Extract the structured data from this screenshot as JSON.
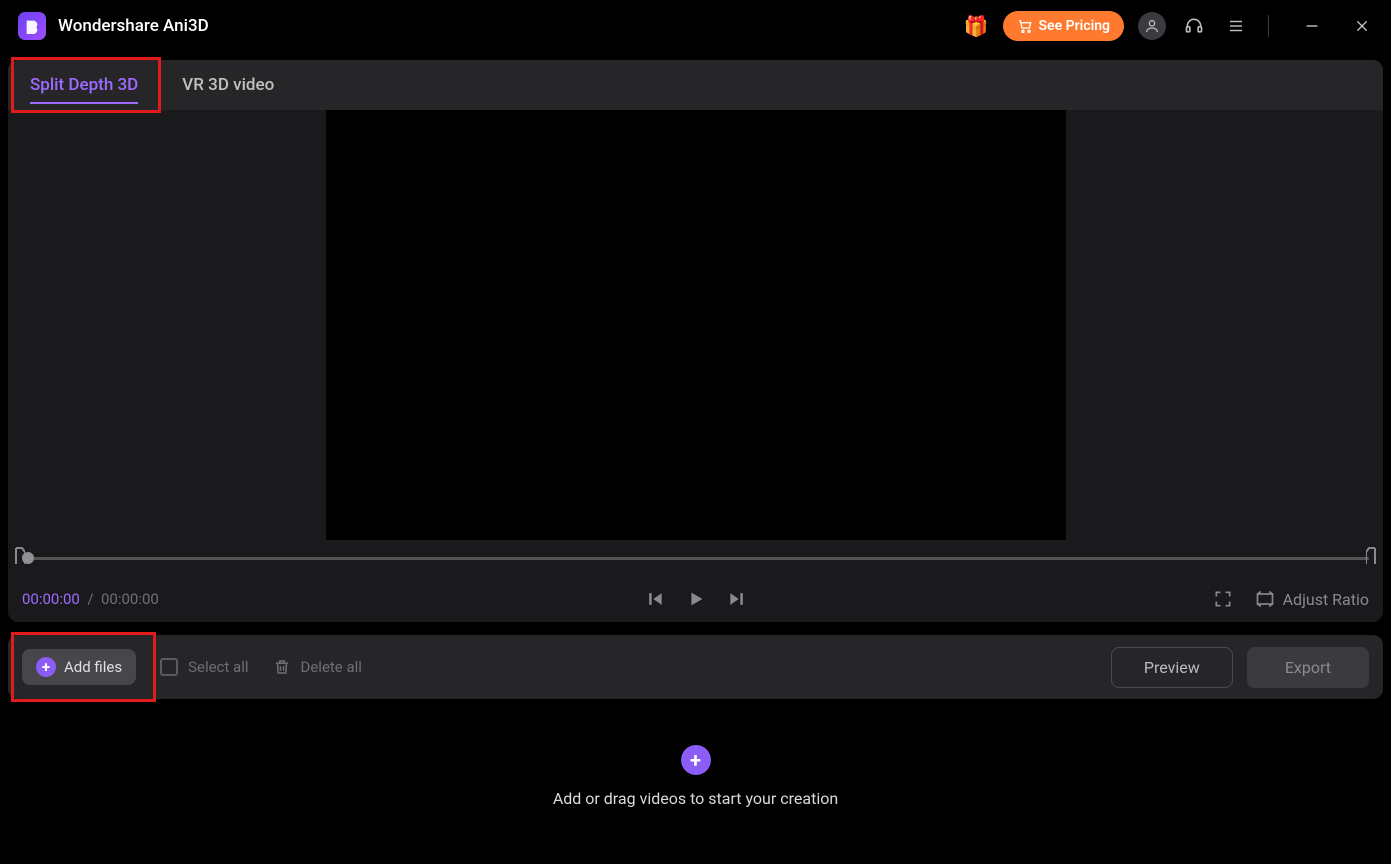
{
  "app": {
    "title": "Wondershare Ani3D"
  },
  "header": {
    "see_pricing_label": "See Pricing"
  },
  "tabs": [
    {
      "label": "Split Depth 3D",
      "active": true
    },
    {
      "label": "VR 3D video",
      "active": false
    }
  ],
  "player": {
    "current_time": "00:00:00",
    "total_time": "00:00:00",
    "separator": "/",
    "adjust_ratio_label": "Adjust Ratio"
  },
  "toolbar": {
    "add_files_label": "Add files",
    "select_all_label": "Select all",
    "delete_all_label": "Delete all",
    "preview_label": "Preview",
    "export_label": "Export"
  },
  "dropzone": {
    "hint": "Add or drag videos to start your creation"
  },
  "colors": {
    "accent": "#8b5cf6",
    "highlight": "#e11b1b",
    "pricing": "#ff7a2f"
  }
}
